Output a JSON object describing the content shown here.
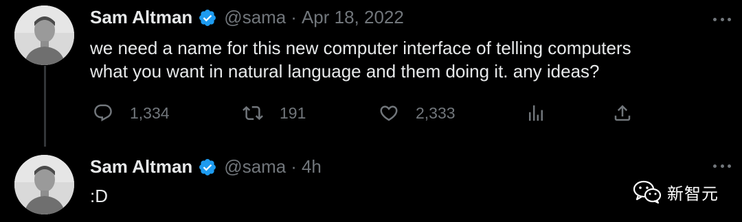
{
  "colors": {
    "background": "#000000",
    "text": "#e7e9ea",
    "muted": "#71767b",
    "verified": "#1d9bf0",
    "thread_line": "#333639"
  },
  "tweets": [
    {
      "author": "Sam Altman",
      "handle": "@sama",
      "separator": "·",
      "time": "Apr 18, 2022",
      "verified_icon": "verified-badge-icon",
      "text": "we need a name for this new computer interface of telling computers\nwhat you want in natural language and them doing it. any ideas?",
      "actions": {
        "reply_count": "1,334",
        "retweet_count": "191",
        "like_count": "2,333"
      }
    },
    {
      "author": "Sam Altman",
      "handle": "@sama",
      "separator": "·",
      "time": "4h",
      "verified_icon": "verified-badge-icon",
      "text": ":D"
    }
  ],
  "icons": {
    "reply": "reply-icon",
    "retweet": "retweet-icon",
    "like": "heart-icon",
    "views": "analytics-icon",
    "share": "share-icon",
    "more": "more-icon",
    "watermark_logo": "wechat-icon"
  },
  "watermark": {
    "text": "新智元"
  }
}
